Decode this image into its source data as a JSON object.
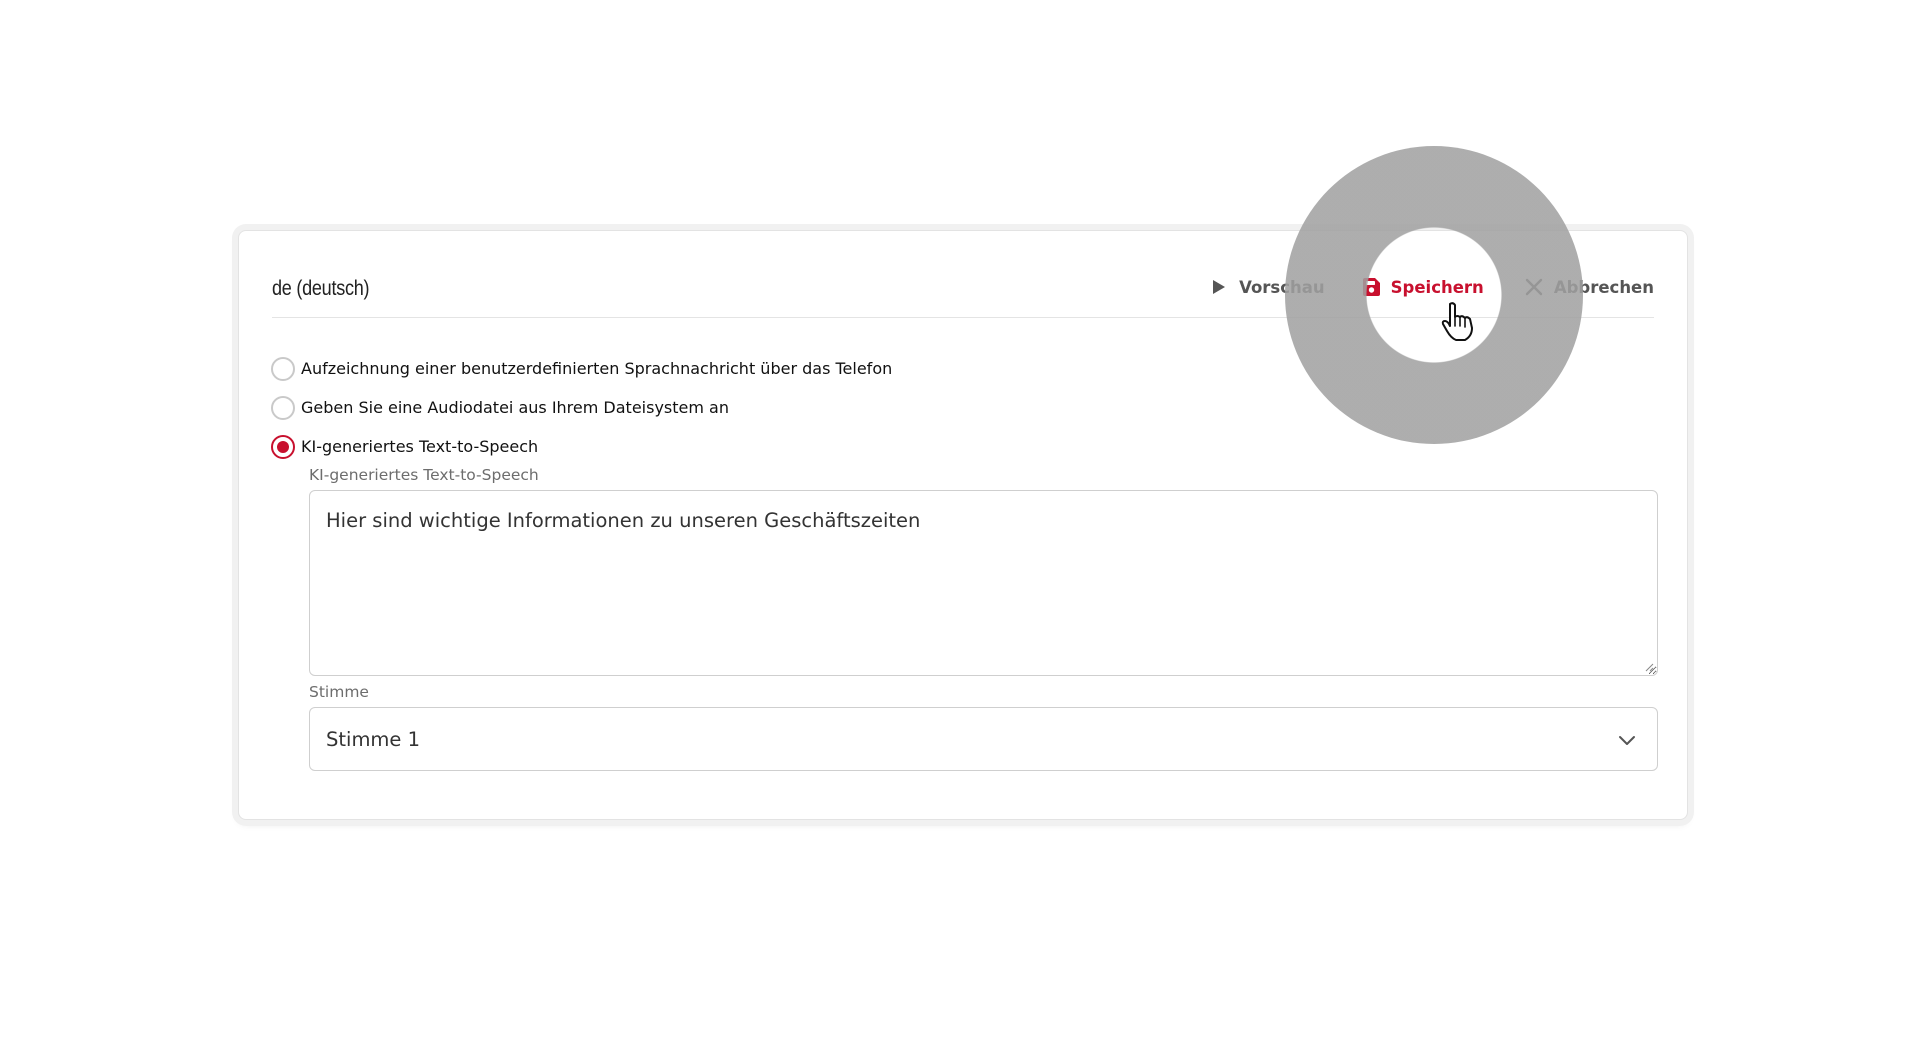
{
  "card": {
    "title": "de (deutsch)",
    "actions": {
      "preview_label": "Vorschau",
      "save_label": "Speichern",
      "cancel_label": "Abbrechen"
    }
  },
  "options": [
    {
      "label": "Aufzeichnung einer benutzerdefinierten Sprachnachricht über das Telefon",
      "selected": false
    },
    {
      "label": "Geben Sie eine Audiodatei aus Ihrem Dateisystem an",
      "selected": false
    },
    {
      "label": "KI-generiertes Text-to-Speech",
      "selected": true
    }
  ],
  "tts": {
    "label": "KI-generiertes Text-to-Speech",
    "value": "Hier sind wichtige Informationen zu unseren Geschäftszeiten"
  },
  "voice": {
    "label": "Stimme",
    "selected": "Stimme 1"
  },
  "colors": {
    "accent": "#c8102e",
    "text_muted": "#6d6d6d",
    "action_gray": "#555555",
    "click_highlight": "#a0a0a0"
  },
  "icons": {
    "preview": "play-icon",
    "save": "floppy-disk-icon",
    "cancel": "close-icon",
    "dropdown": "chevron-down-icon",
    "cursor": "hand-pointer-icon"
  }
}
